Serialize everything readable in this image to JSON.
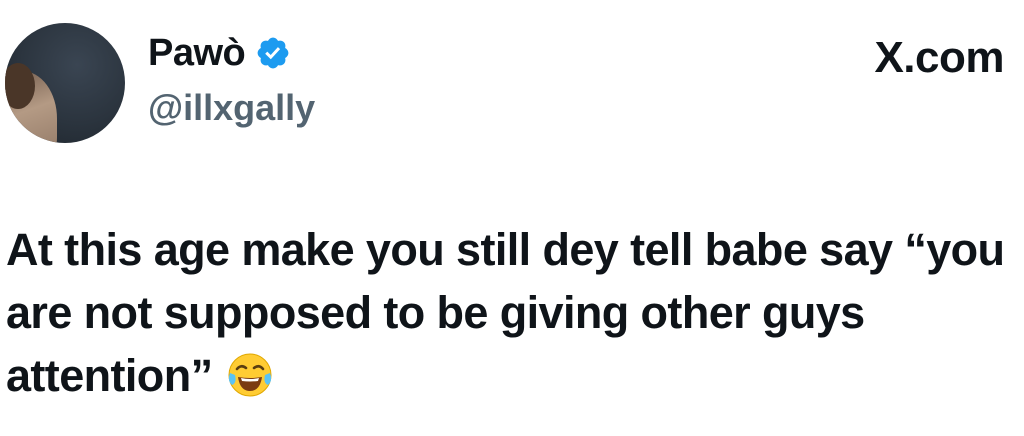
{
  "user": {
    "display_name": "Pawò",
    "handle": "@illxgally",
    "verified": true,
    "avatar_icon": "profile-photo"
  },
  "brand": "X.com",
  "tweet": {
    "text": "At this age make you still dey tell babe say “you are not supposed to be giving other guys attention”",
    "emoji": "face-with-tears-of-joy-icon"
  },
  "colors": {
    "text": "#0f1419",
    "secondary": "#536471",
    "verified": "#1d9bf0"
  }
}
